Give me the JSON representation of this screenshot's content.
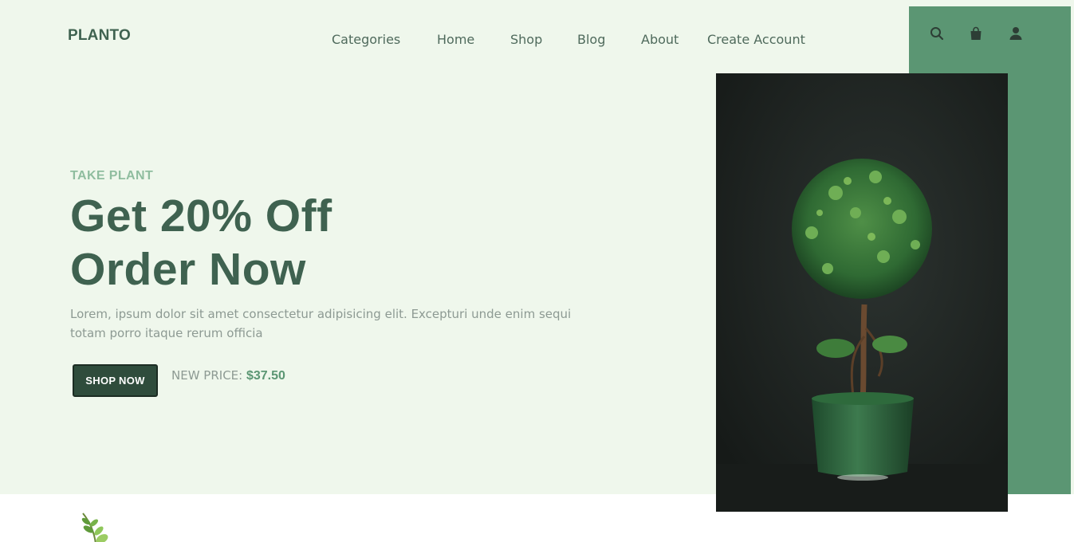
{
  "brand": {
    "logo": "PLANTO"
  },
  "nav": {
    "items": [
      "Categories",
      "Home",
      "Shop",
      "Blog",
      "About",
      "Create Account"
    ]
  },
  "header_icons": [
    "search-icon",
    "shopping-bag-icon",
    "user-icon"
  ],
  "hero": {
    "eyebrow": "TAKE PLANT",
    "headline_line1": "Get 20% Off",
    "headline_line2": "Order Now",
    "description": "Lorem, ipsum dolor sit amet consectetur adipisicing elit. Excepturi unde enim sequi totam porro itaque rerum officia",
    "cta_label": "SHOP NOW",
    "price_label": "NEW PRICE:",
    "price_value": "$37.50"
  },
  "colors": {
    "hero_background": "#eff7ec",
    "accent_green": "#5b9673",
    "dark_green": "#3f6250",
    "button_green": "#2f4c3c"
  }
}
